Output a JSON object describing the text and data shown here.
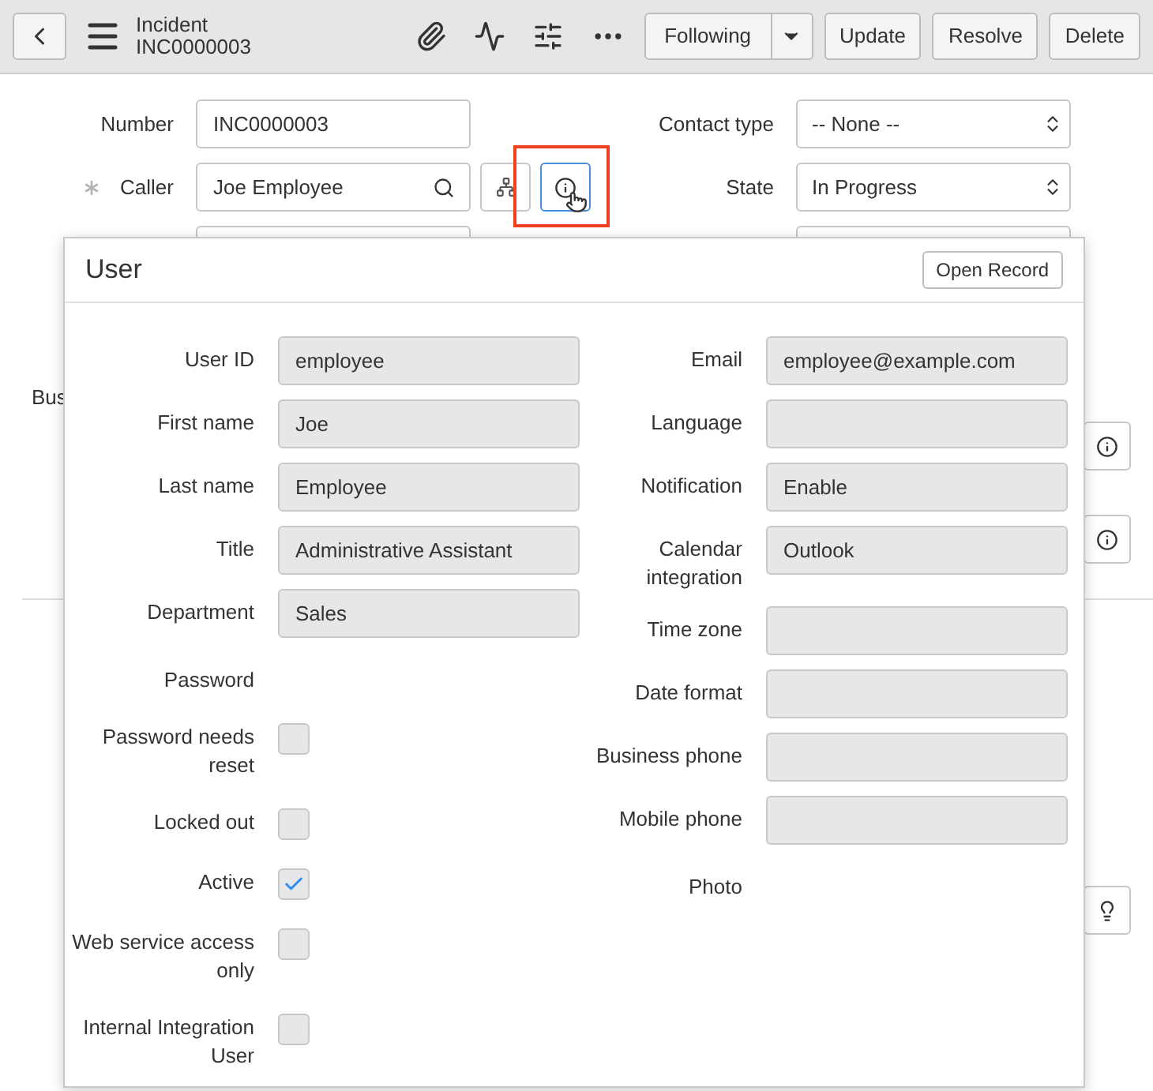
{
  "header": {
    "title": "Incident",
    "subtitle": "INC0000003",
    "follow_button": "Following",
    "buttons": [
      "Update",
      "Resolve",
      "Delete"
    ]
  },
  "form": {
    "left": [
      {
        "label": "Number",
        "value": "INC0000003",
        "required": false,
        "kind": "text"
      },
      {
        "label": "Caller",
        "value": "Joe Employee",
        "required": true,
        "kind": "reference"
      }
    ],
    "right": [
      {
        "label": "Contact type",
        "value": "-- None --",
        "kind": "select"
      },
      {
        "label": "State",
        "value": "In Progress",
        "kind": "select"
      }
    ],
    "hidden_labels": [
      "Bus"
    ]
  },
  "popup": {
    "title": "User",
    "open_record": "Open Record",
    "left": [
      {
        "label": "User ID",
        "kind": "text",
        "value": "employee"
      },
      {
        "label": "First name",
        "kind": "text",
        "value": "Joe"
      },
      {
        "label": "Last name",
        "kind": "text",
        "value": "Employee"
      },
      {
        "label": "Title",
        "kind": "text",
        "value": "Administrative Assistant"
      },
      {
        "label": "Department",
        "kind": "text",
        "value": "Sales"
      },
      {
        "label": "Password",
        "kind": "none"
      },
      {
        "label": "Password needs reset",
        "kind": "checkbox",
        "checked": false
      },
      {
        "label": "Locked out",
        "kind": "checkbox",
        "checked": false
      },
      {
        "label": "Active",
        "kind": "checkbox",
        "checked": true
      },
      {
        "label": "Web service access only",
        "kind": "checkbox",
        "checked": false
      },
      {
        "label": "Internal Integration User",
        "kind": "checkbox",
        "checked": false
      }
    ],
    "right": [
      {
        "label": "Email",
        "kind": "text",
        "value": "employee@example.com"
      },
      {
        "label": "Language",
        "kind": "text"
      },
      {
        "label": "Notification",
        "kind": "text",
        "value": "Enable"
      },
      {
        "label": "Calendar integration",
        "kind": "text",
        "value": "Outlook"
      },
      {
        "label": "Time zone",
        "kind": "text"
      },
      {
        "label": "Date format",
        "kind": "text"
      },
      {
        "label": "Business phone",
        "kind": "text"
      },
      {
        "label": "Mobile phone",
        "kind": "text"
      },
      {
        "label": "Photo",
        "kind": "none"
      }
    ]
  }
}
